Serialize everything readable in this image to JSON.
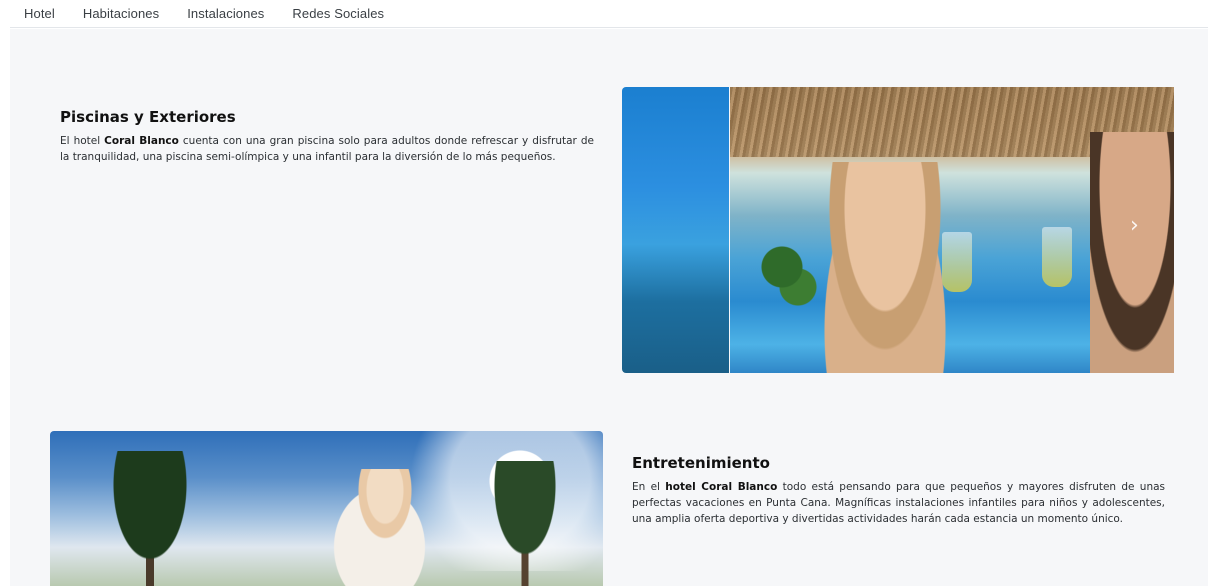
{
  "nav": {
    "items": [
      "Hotel",
      "Habitaciones",
      "Instalaciones",
      "Redes Sociales"
    ]
  },
  "section1": {
    "title": "Piscinas y Exteriores",
    "text_before": "El hotel ",
    "text_bold": "Coral Blanco",
    "text_after": " cuenta con una gran piscina solo para adultos donde refrescar y disfrutar de la tranquilidad, una piscina semi-olímpica y una infantil para la diversión de lo más pequeños."
  },
  "section2": {
    "title": "Entretenimiento",
    "text_before": "En el ",
    "text_bold": "hotel Coral Blanco",
    "text_after": " todo está pensando para que pequeños y mayores disfruten de unas perfectas vacaciones en Punta Cana. Magníficas instalaciones infantiles para niños y adolescentes, una amplia oferta deportiva y divertidas actividades harán cada estancia un momento único."
  },
  "carousel": {
    "next_glyph": "›"
  }
}
